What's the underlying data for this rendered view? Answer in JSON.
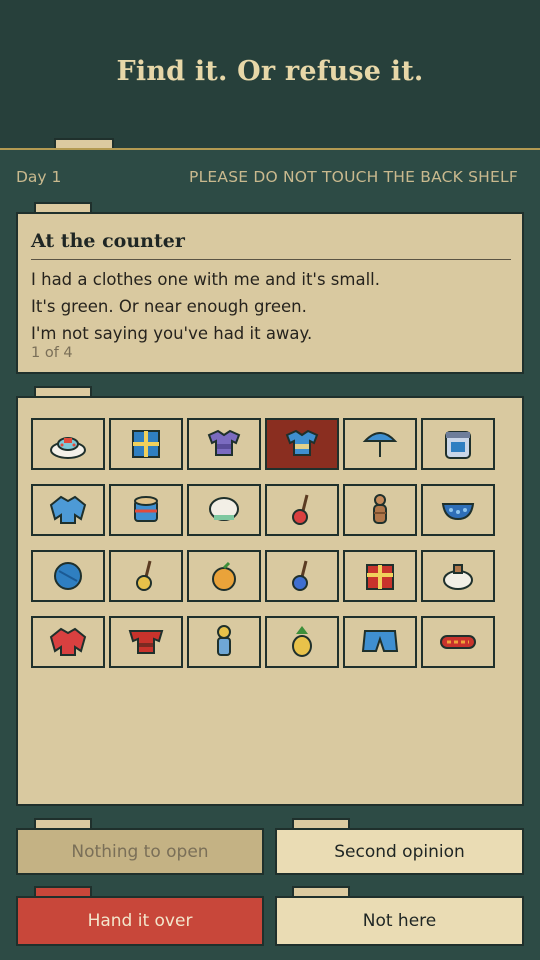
{
  "header": {
    "title": "Find it. Or refuse it."
  },
  "status": {
    "day": "Day 1",
    "notice": "PLEASE DO NOT TOUCH THE BACK SHELF"
  },
  "counter": {
    "heading": "At the counter",
    "lines": [
      "I had a clothes one with me and it's small.",
      "It's green. Or near enough green.",
      "I'm not saying you've had it away."
    ],
    "pager": "1 of 4"
  },
  "colors": {
    "background": "#2d4b45",
    "header": "#27403b",
    "paper": "#d9c9a0",
    "selected": "#8a2e20",
    "primary": "#c8473a"
  },
  "items": [
    {
      "icon": "cake-icon"
    },
    {
      "icon": "gift-box-blue-icon"
    },
    {
      "icon": "purple-shirt-icon"
    },
    {
      "icon": "blue-shirt-icon",
      "selected": true
    },
    {
      "icon": "blue-umbrella-icon"
    },
    {
      "icon": "jar-icon"
    },
    {
      "icon": "blue-sweater-icon"
    },
    {
      "icon": "toy-drum-icon"
    },
    {
      "icon": "white-hat-icon"
    },
    {
      "icon": "red-guitar-icon"
    },
    {
      "icon": "wooden-doll-icon"
    },
    {
      "icon": "blue-bowl-icon"
    },
    {
      "icon": "blue-ball-icon"
    },
    {
      "icon": "yellow-guitar-icon"
    },
    {
      "icon": "orange-fruit-icon"
    },
    {
      "icon": "blue-guitar-icon"
    },
    {
      "icon": "red-gift-icon"
    },
    {
      "icon": "white-bag-icon"
    },
    {
      "icon": "red-sweater-icon"
    },
    {
      "icon": "red-shirt-icon"
    },
    {
      "icon": "yellow-doll-icon"
    },
    {
      "icon": "pineapple-icon"
    },
    {
      "icon": "blue-shorts-icon"
    },
    {
      "icon": "red-scarf-icon"
    }
  ],
  "actions": {
    "open": "Nothing to open",
    "second": "Second opinion",
    "hand": "Hand it over",
    "not_here": "Not here"
  }
}
